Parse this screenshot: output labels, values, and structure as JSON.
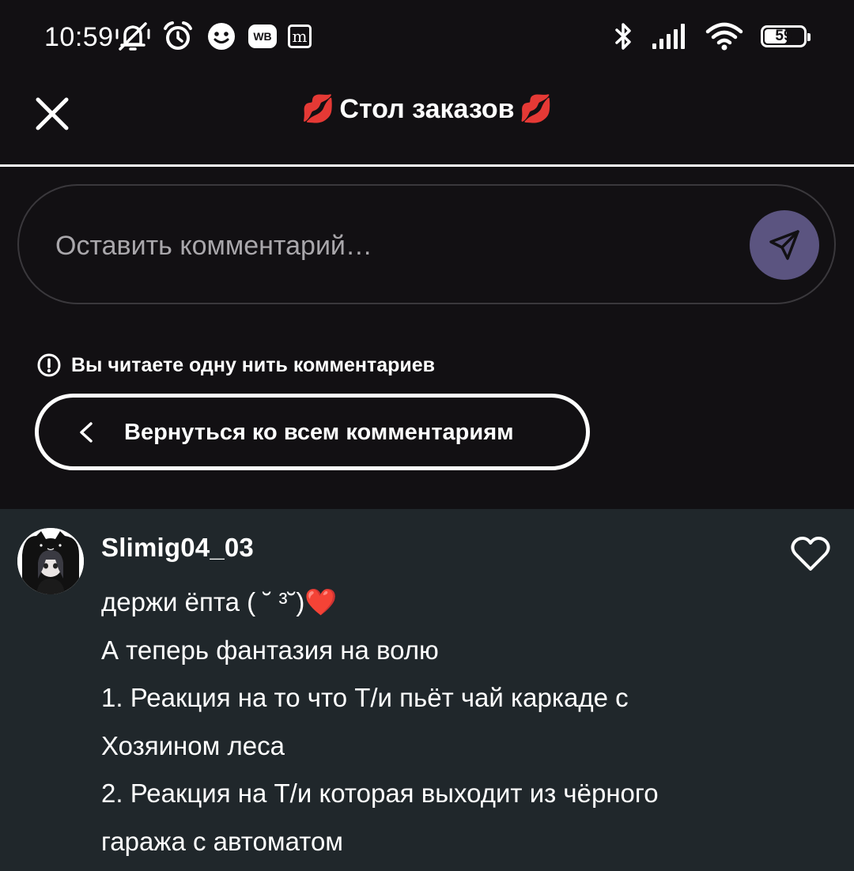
{
  "status_bar": {
    "time": "10:59",
    "left_icons": [
      "muted-bell-icon",
      "alarm-icon",
      "chat-face-icon",
      "wb-app-icon",
      "m-app-icon"
    ],
    "wb_label": "WB",
    "m_label": "m",
    "right_icons": [
      "bluetooth-icon",
      "signal-icon",
      "wifi-icon",
      "battery-icon"
    ],
    "battery_level": "59",
    "battery_fraction": 0.59
  },
  "header": {
    "close_icon": "close-icon",
    "title_emoji": "💋",
    "title": "Стол заказов"
  },
  "comment_input": {
    "placeholder": "Оставить комментарий…",
    "value": "",
    "send_icon": "send-icon",
    "send_color": "#5b5480"
  },
  "thread": {
    "notice_icon": "info-icon",
    "notice": "Вы читаете одну нить комментариев",
    "back_icon": "chevron-left-icon",
    "back_label": "Вернуться ко всем комментариям"
  },
  "comment": {
    "username": "Slimig04_03",
    "avatar": "avatar-image",
    "like_icon": "heart-outline-icon",
    "lines": [
      "держи ёпта ( ˘ ³˘)❤️",
      "А теперь фантазия на волю",
      "1. Реакция на то что Т/и пьёт чай каркаде с",
      "Хозяином леса",
      "2. Реакция на Т/и которая выходит из чёрного",
      "гаража с автоматом"
    ]
  },
  "colors": {
    "background": "#121013",
    "card_background": "#20272b",
    "accent": "#5b5480",
    "text": "#ffffff",
    "placeholder": "#a9a7ab"
  }
}
